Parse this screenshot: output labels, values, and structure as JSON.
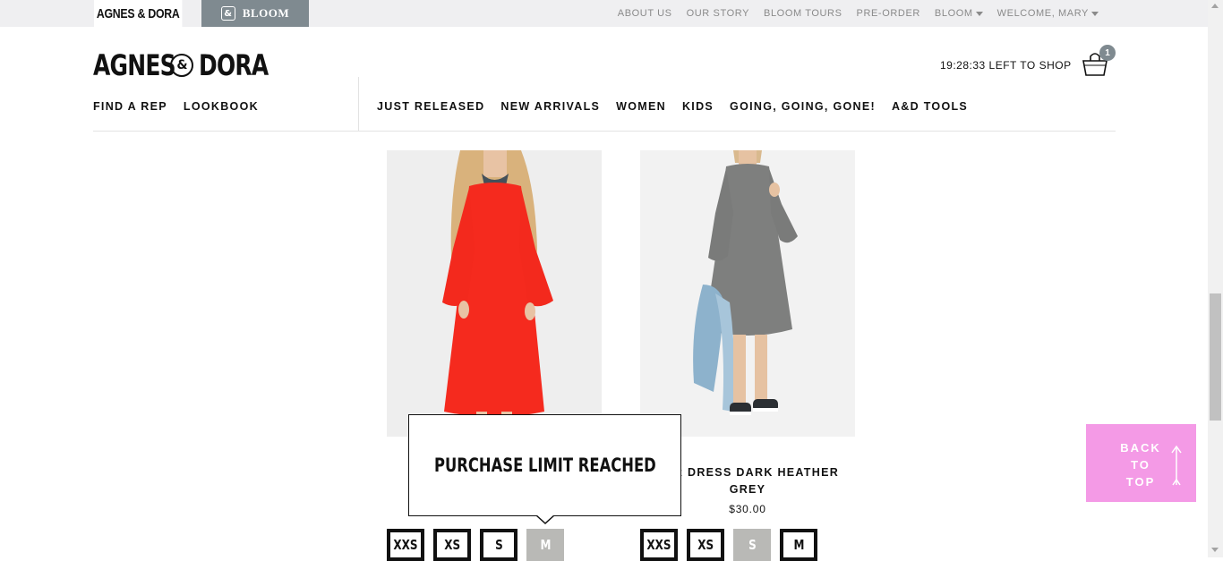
{
  "topbar": {
    "brand_tab": "AGNES & DORA",
    "bloom_tab": "BLOOM",
    "links": [
      "ABOUT US",
      "OUR STORY",
      "BLOOM TOURS",
      "PRE-ORDER"
    ],
    "bloom_menu": "BLOOM",
    "welcome": "WELCOME, MARY"
  },
  "header": {
    "logo_left": "AGNES",
    "logo_amp": "&",
    "logo_right": "DORA",
    "timer": "19:28:33 LEFT TO SHOP",
    "cart_count": "1"
  },
  "nav": {
    "left": [
      "FIND A REP",
      "LOOKBOOK"
    ],
    "right": [
      "JUST RELEASED",
      "NEW ARRIVALS",
      "WOMEN",
      "KIDS",
      "GOING, GOING, GONE!",
      "A&D TOOLS"
    ]
  },
  "products": [
    {
      "image": "red-dress-photo",
      "sizes": [
        {
          "label": "XXS",
          "available": true
        },
        {
          "label": "XS",
          "available": true
        },
        {
          "label": "S",
          "available": true
        },
        {
          "label": "M",
          "available": false
        }
      ]
    },
    {
      "image": "grey-dress-photo",
      "title_line1": "KER DRESS DARK HEATHER",
      "title_line2": "GREY",
      "price": "$30.00",
      "sizes": [
        {
          "label": "XXS",
          "available": true
        },
        {
          "label": "XS",
          "available": true
        },
        {
          "label": "S",
          "available": false
        },
        {
          "label": "M",
          "available": true
        }
      ]
    }
  ],
  "tooltip": {
    "message": "PURCHASE LIMIT REACHED"
  },
  "back_to_top": {
    "line1": "BACK",
    "line2": "TO",
    "line3": "TOP"
  },
  "colors": {
    "bloom_tab": "#7f8a90",
    "back_to_top": "#f49ae6",
    "disabled_size": "#b9b9b6",
    "topbar_bg": "#efeff1"
  }
}
